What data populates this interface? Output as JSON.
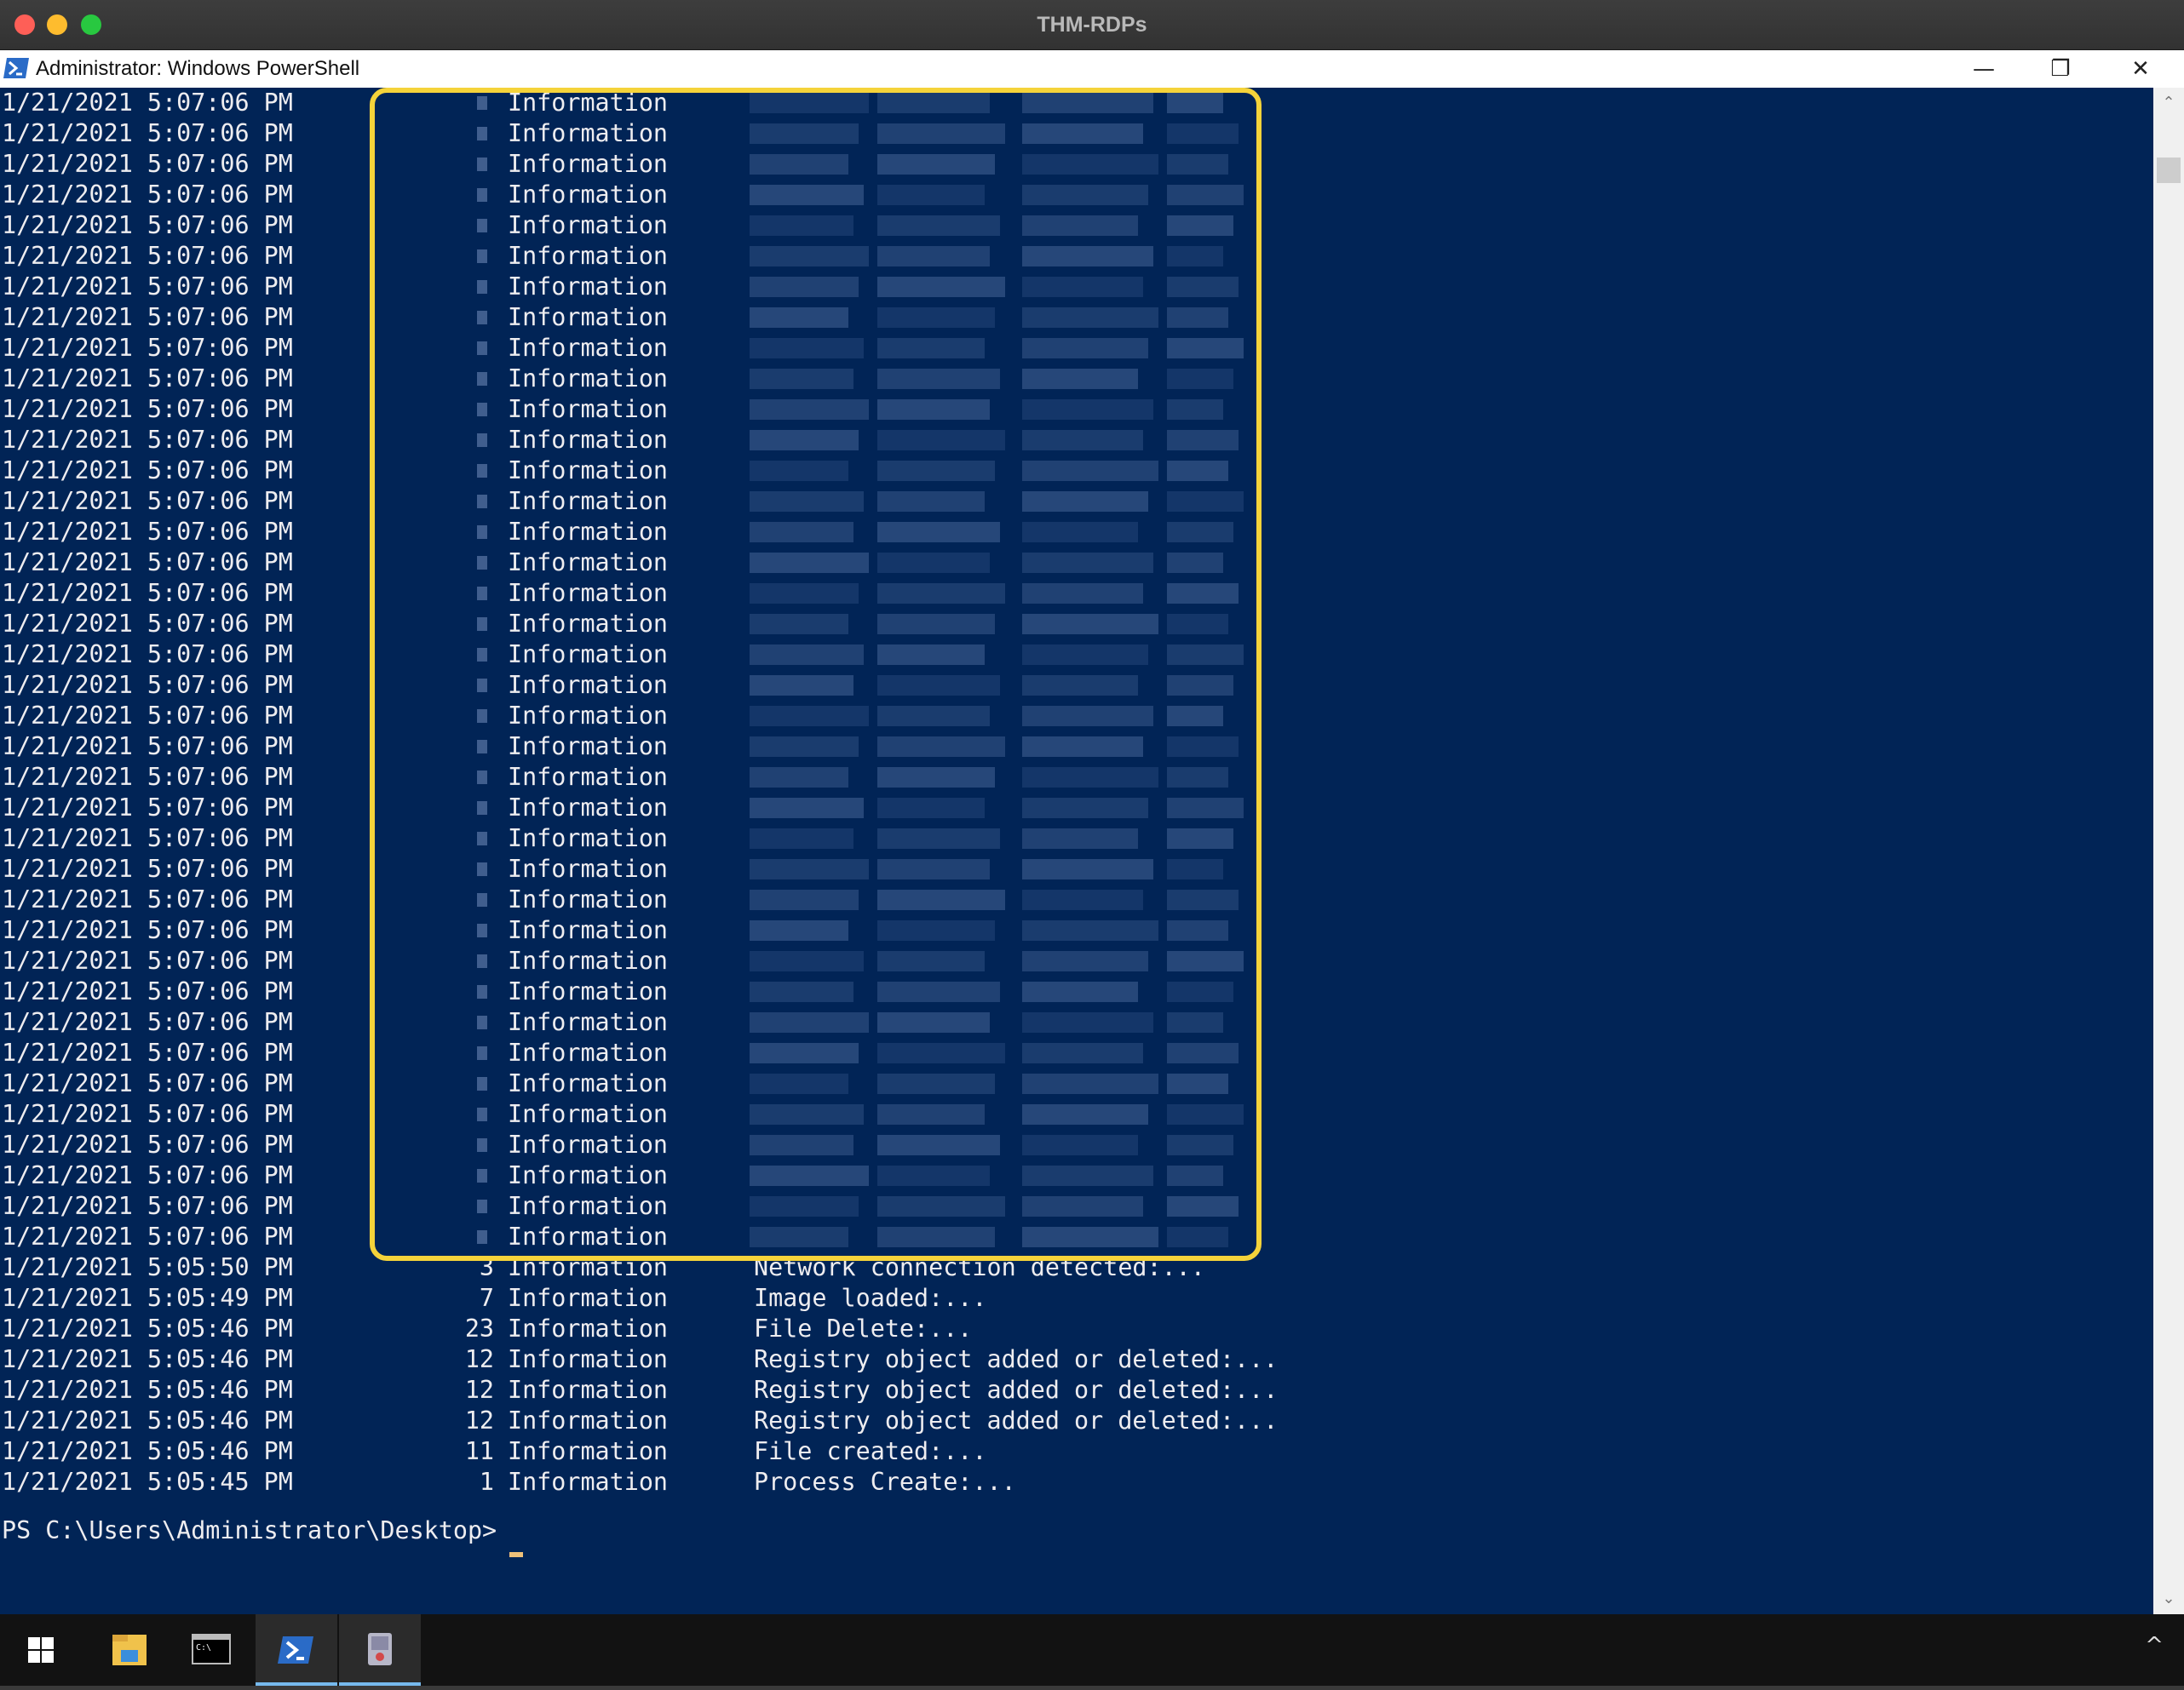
{
  "mac_window": {
    "title": "THM-RDPs",
    "colors": {
      "close": "#fe5f57",
      "minimize": "#febc2e",
      "maximize": "#28c840"
    }
  },
  "window": {
    "title": "Administrator: Windows PowerShell",
    "icon": "powershell-icon",
    "controls": {
      "minimize": "—",
      "restore": "❐",
      "close": "✕"
    }
  },
  "console": {
    "background": "#012456",
    "highlight_color": "#f5d33a",
    "blurred_rows": [
      {
        "date": "1/21/2021 5:07:06 PM",
        "type": "Information"
      },
      {
        "date": "1/21/2021 5:07:06 PM",
        "type": "Information"
      },
      {
        "date": "1/21/2021 5:07:06 PM",
        "type": "Information"
      },
      {
        "date": "1/21/2021 5:07:06 PM",
        "type": "Information"
      },
      {
        "date": "1/21/2021 5:07:06 PM",
        "type": "Information"
      },
      {
        "date": "1/21/2021 5:07:06 PM",
        "type": "Information"
      },
      {
        "date": "1/21/2021 5:07:06 PM",
        "type": "Information"
      },
      {
        "date": "1/21/2021 5:07:06 PM",
        "type": "Information"
      },
      {
        "date": "1/21/2021 5:07:06 PM",
        "type": "Information"
      },
      {
        "date": "1/21/2021 5:07:06 PM",
        "type": "Information"
      },
      {
        "date": "1/21/2021 5:07:06 PM",
        "type": "Information"
      },
      {
        "date": "1/21/2021 5:07:06 PM",
        "type": "Information"
      },
      {
        "date": "1/21/2021 5:07:06 PM",
        "type": "Information"
      },
      {
        "date": "1/21/2021 5:07:06 PM",
        "type": "Information"
      },
      {
        "date": "1/21/2021 5:07:06 PM",
        "type": "Information"
      },
      {
        "date": "1/21/2021 5:07:06 PM",
        "type": "Information"
      },
      {
        "date": "1/21/2021 5:07:06 PM",
        "type": "Information"
      },
      {
        "date": "1/21/2021 5:07:06 PM",
        "type": "Information"
      },
      {
        "date": "1/21/2021 5:07:06 PM",
        "type": "Information"
      },
      {
        "date": "1/21/2021 5:07:06 PM",
        "type": "Information"
      },
      {
        "date": "1/21/2021 5:07:06 PM",
        "type": "Information"
      },
      {
        "date": "1/21/2021 5:07:06 PM",
        "type": "Information"
      },
      {
        "date": "1/21/2021 5:07:06 PM",
        "type": "Information"
      },
      {
        "date": "1/21/2021 5:07:06 PM",
        "type": "Information"
      },
      {
        "date": "1/21/2021 5:07:06 PM",
        "type": "Information"
      },
      {
        "date": "1/21/2021 5:07:06 PM",
        "type": "Information"
      },
      {
        "date": "1/21/2021 5:07:06 PM",
        "type": "Information"
      },
      {
        "date": "1/21/2021 5:07:06 PM",
        "type": "Information"
      },
      {
        "date": "1/21/2021 5:07:06 PM",
        "type": "Information"
      },
      {
        "date": "1/21/2021 5:07:06 PM",
        "type": "Information"
      },
      {
        "date": "1/21/2021 5:07:06 PM",
        "type": "Information"
      },
      {
        "date": "1/21/2021 5:07:06 PM",
        "type": "Information"
      },
      {
        "date": "1/21/2021 5:07:06 PM",
        "type": "Information"
      },
      {
        "date": "1/21/2021 5:07:06 PM",
        "type": "Information"
      },
      {
        "date": "1/21/2021 5:07:06 PM",
        "type": "Information"
      },
      {
        "date": "1/21/2021 5:07:06 PM",
        "type": "Information"
      },
      {
        "date": "1/21/2021 5:07:06 PM",
        "type": "Information"
      },
      {
        "date": "1/21/2021 5:07:06 PM",
        "type": "Information"
      }
    ],
    "rows": [
      {
        "date": "1/21/2021 5:05:50 PM",
        "id": "3",
        "type": "Information",
        "message": "Network connection detected:..."
      },
      {
        "date": "1/21/2021 5:05:49 PM",
        "id": "7",
        "type": "Information",
        "message": "Image loaded:..."
      },
      {
        "date": "1/21/2021 5:05:46 PM",
        "id": "23",
        "type": "Information",
        "message": "File Delete:..."
      },
      {
        "date": "1/21/2021 5:05:46 PM",
        "id": "12",
        "type": "Information",
        "message": "Registry object added or deleted:..."
      },
      {
        "date": "1/21/2021 5:05:46 PM",
        "id": "12",
        "type": "Information",
        "message": "Registry object added or deleted:..."
      },
      {
        "date": "1/21/2021 5:05:46 PM",
        "id": "12",
        "type": "Information",
        "message": "Registry object added or deleted:..."
      },
      {
        "date": "1/21/2021 5:05:46 PM",
        "id": "11",
        "type": "Information",
        "message": "File created:..."
      },
      {
        "date": "1/21/2021 5:05:45 PM",
        "id": "1",
        "type": "Information",
        "message": "Process Create:..."
      }
    ],
    "prompt": "PS C:\\Users\\Administrator\\Desktop>"
  },
  "scrollbar": {
    "up": "⌃",
    "down": "⌄"
  },
  "taskbar": {
    "items": [
      {
        "name": "start-button",
        "icon": "windows-logo-icon"
      },
      {
        "name": "file-explorer-button",
        "icon": "folder-icon"
      },
      {
        "name": "command-prompt-button",
        "icon": "terminal-icon"
      },
      {
        "name": "powershell-taskbar-button",
        "icon": "powershell-icon",
        "active": true
      },
      {
        "name": "app-taskbar-button",
        "icon": "app-icon"
      }
    ],
    "tray_chevron": "^"
  }
}
